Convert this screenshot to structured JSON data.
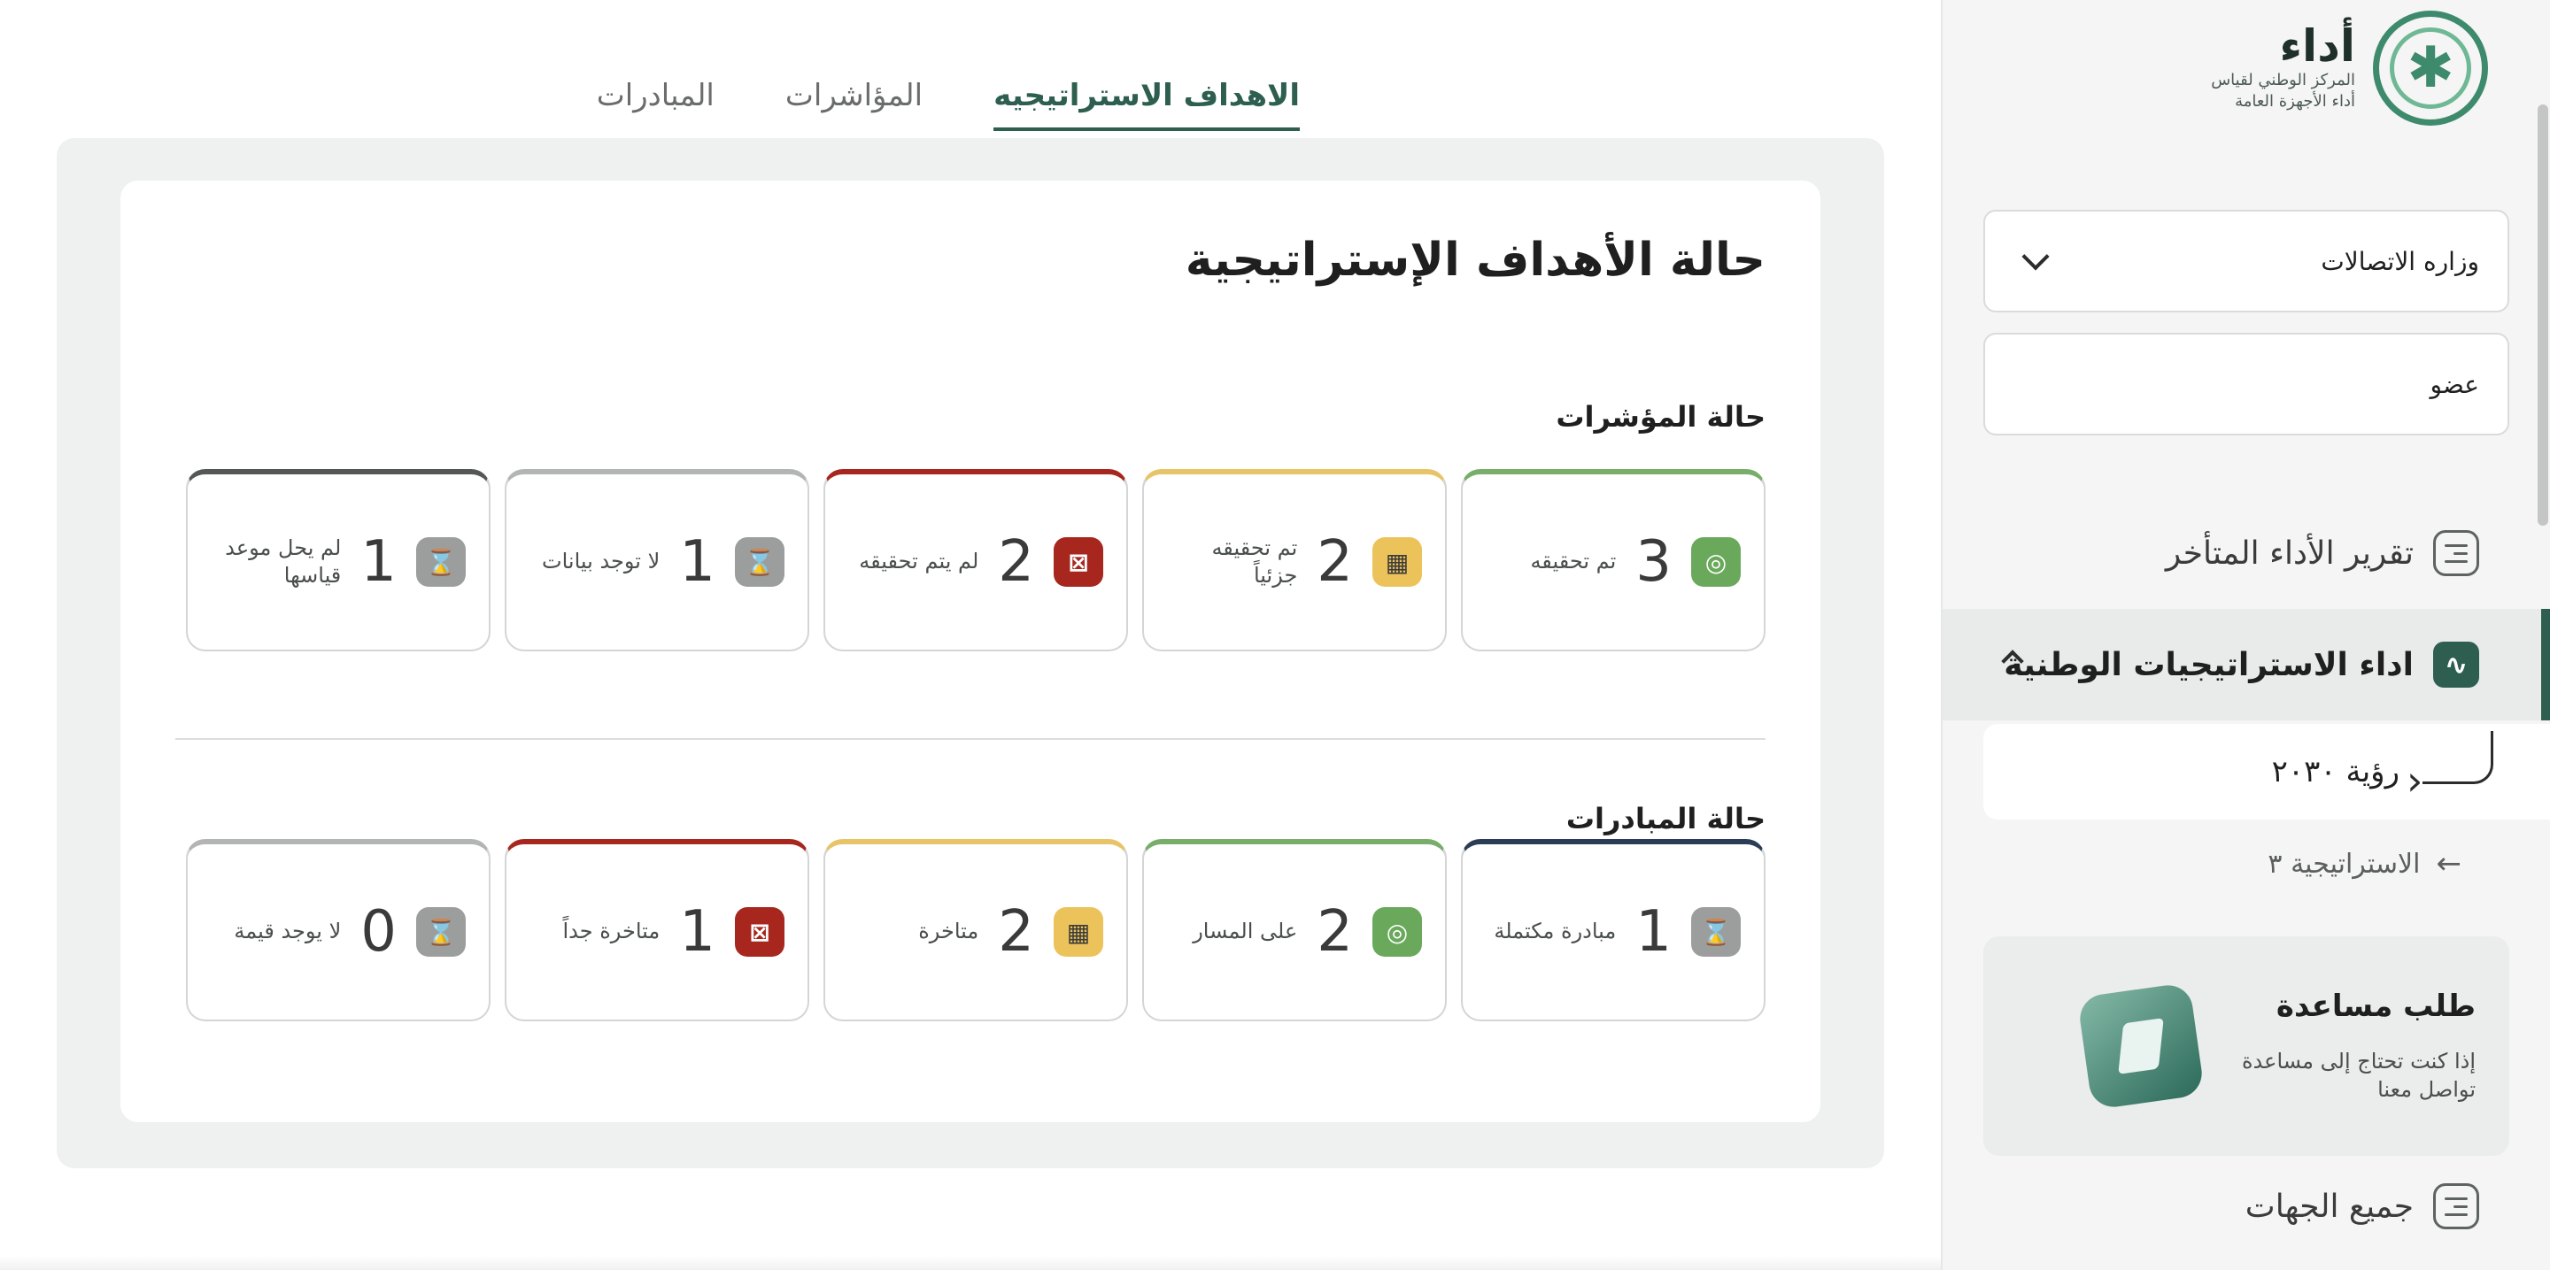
{
  "brand": {
    "name": "أداء",
    "subtitle_line1": "المركز الوطني لقياس",
    "subtitle_line2": "أداء الأجهزة العامة",
    "color_primary": "#2d5e4f"
  },
  "sidebar": {
    "entity_select": {
      "value": "وزاره الاتصالات"
    },
    "role_select": {
      "value": "عضو"
    },
    "items": {
      "late_report": "تقرير الأداء المتأخر",
      "national_strategies": "اداء الاستراتيجيات الوطنية",
      "all_entities": "جميع الجهات"
    },
    "sub_items": {
      "vision": "رؤية ٢٠٣٠",
      "strategy": "الاستراتيجية ٣"
    },
    "help": {
      "title": "طلب مساعدة",
      "line1": "إذا كنت تحتاج إلى مساعدة",
      "line2": "تواصل معنا"
    }
  },
  "tabs": [
    {
      "label": "الاهداف الاستراتيجيه",
      "active": true
    },
    {
      "label": "المؤاشرات",
      "active": false
    },
    {
      "label": "المبادرات",
      "active": false
    }
  ],
  "main": {
    "title": "حالة الأهداف الإستراتيجية",
    "indicators_title": "حالة المؤشرات",
    "initiatives_title": "حالة المبادرات",
    "indicators": [
      {
        "value": "3",
        "label": "تم تحقيقه",
        "icon": "target-icon",
        "color": "#6aa95c"
      },
      {
        "value": "2",
        "label": "تم تحقيقه جزئياً",
        "icon": "barrier-icon",
        "color": "#ecc35a"
      },
      {
        "value": "2",
        "label": "لم يتم تحقيقه",
        "icon": "close-icon",
        "color": "#a7271f"
      },
      {
        "value": "1",
        "label": "لا توجد بيانات",
        "icon": "hourglass-icon",
        "color": "#9c9e9d"
      },
      {
        "value": "1",
        "label": "لم يحل موعد قياسها",
        "icon": "hourglass-icon",
        "color": "#9c9e9d"
      }
    ],
    "initiatives": [
      {
        "value": "1",
        "label": "مبادرة مكتملة",
        "icon": "hourglass-icon",
        "color": "#9c9e9d"
      },
      {
        "value": "2",
        "label": "على المسار",
        "icon": "target-icon",
        "color": "#6aa95c"
      },
      {
        "value": "2",
        "label": "متاخرة",
        "icon": "barrier-icon",
        "color": "#ecc35a"
      },
      {
        "value": "1",
        "label": "متاخرة جداً",
        "icon": "close-icon",
        "color": "#a7271f"
      },
      {
        "value": "0",
        "label": "لا يوجد قيمة",
        "icon": "hourglass-icon",
        "color": "#9c9e9d"
      }
    ]
  }
}
